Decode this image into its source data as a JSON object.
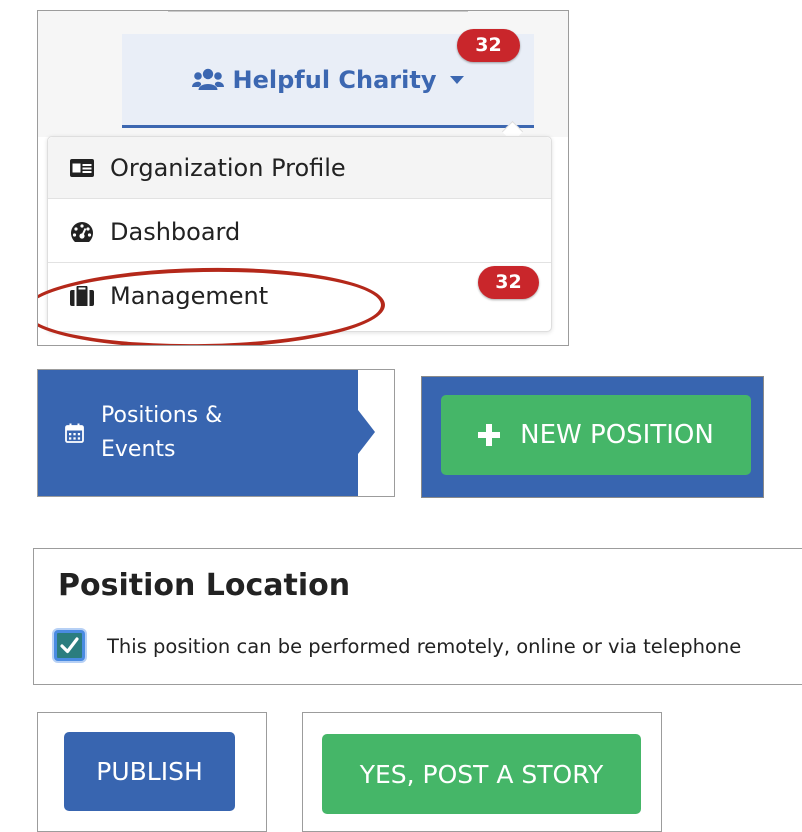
{
  "org_menu": {
    "org_name": "Helpful Charity",
    "notification_count": "32",
    "items": [
      {
        "label": "Organization Profile",
        "icon": "id-card-icon"
      },
      {
        "label": "Dashboard",
        "icon": "tachometer-icon"
      },
      {
        "label": "Management",
        "icon": "briefcase-icon",
        "badge": "32"
      }
    ],
    "highlight_color": "#b4281a"
  },
  "nav": {
    "positions_line1": "Positions &",
    "positions_line2": "Events"
  },
  "new_position": {
    "label": "NEW POSITION"
  },
  "location": {
    "heading": "Position Location",
    "remote_checked": true,
    "remote_label": "This position can be performed remotely, online or via telephone"
  },
  "actions": {
    "publish_label": "PUBLISH",
    "post_story_label": "YES, POST A STORY"
  },
  "colors": {
    "primary_blue": "#3865b0",
    "success_green": "#45b668",
    "badge_red": "#c9262b"
  }
}
